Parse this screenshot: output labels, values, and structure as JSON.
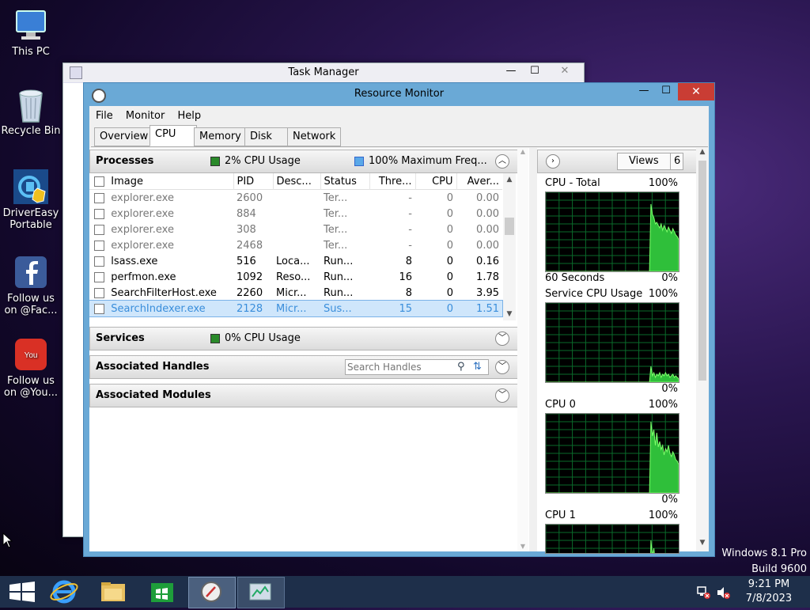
{
  "desktop": {
    "icons": [
      {
        "label": "This PC",
        "icon": "computer-icon"
      },
      {
        "label": "Recycle Bin",
        "icon": "recycle-bin-icon"
      },
      {
        "label": "DriverEasy Portable",
        "icon": "drivereasy-icon"
      },
      {
        "label": "Follow us on @Fac...",
        "icon": "facebook-icon"
      },
      {
        "label": "Follow us on @You...",
        "icon": "youtube-icon"
      }
    ],
    "watermark_line1": "Windows 8.1 Pro",
    "watermark_line2": "Build 9600"
  },
  "task_manager": {
    "title": "Task Manager"
  },
  "resource_monitor": {
    "title": "Resource Monitor",
    "menu": [
      "File",
      "Monitor",
      "Help"
    ],
    "tabs": [
      "Overview",
      "CPU",
      "Memory",
      "Disk",
      "Network"
    ],
    "active_tab": "CPU",
    "processes": {
      "title": "Processes",
      "cpu_usage": "2% CPU Usage",
      "max_freq": "100% Maximum Freq...",
      "columns": [
        "Image",
        "PID",
        "Desc...",
        "Status",
        "Thre...",
        "CPU",
        "Aver..."
      ],
      "rows": [
        {
          "image": "explorer.exe",
          "pid": "2600",
          "desc": "",
          "status": "Ter...",
          "threads": "-",
          "cpu": "0",
          "avg": "0.00",
          "terminated": true
        },
        {
          "image": "explorer.exe",
          "pid": "884",
          "desc": "",
          "status": "Ter...",
          "threads": "-",
          "cpu": "0",
          "avg": "0.00",
          "terminated": true
        },
        {
          "image": "explorer.exe",
          "pid": "308",
          "desc": "",
          "status": "Ter...",
          "threads": "-",
          "cpu": "0",
          "avg": "0.00",
          "terminated": true
        },
        {
          "image": "explorer.exe",
          "pid": "2468",
          "desc": "",
          "status": "Ter...",
          "threads": "-",
          "cpu": "0",
          "avg": "0.00",
          "terminated": true
        },
        {
          "image": "lsass.exe",
          "pid": "516",
          "desc": "Loca...",
          "status": "Run...",
          "threads": "8",
          "cpu": "0",
          "avg": "0.16"
        },
        {
          "image": "perfmon.exe",
          "pid": "1092",
          "desc": "Reso...",
          "status": "Run...",
          "threads": "16",
          "cpu": "0",
          "avg": "1.78"
        },
        {
          "image": "SearchFilterHost.exe",
          "pid": "2260",
          "desc": "Micr...",
          "status": "Run...",
          "threads": "8",
          "cpu": "0",
          "avg": "3.95"
        },
        {
          "image": "SearchIndexer.exe",
          "pid": "2128",
          "desc": "Micr...",
          "status": "Sus...",
          "threads": "15",
          "cpu": "0",
          "avg": "1.51",
          "selected": true
        }
      ]
    },
    "services": {
      "title": "Services",
      "cpu_usage": "0% CPU Usage"
    },
    "handles": {
      "title": "Associated Handles",
      "search_placeholder": "Search Handles"
    },
    "modules": {
      "title": "Associated Modules"
    },
    "right_panel": {
      "views_label": "Views",
      "views_count": "6",
      "graphs": [
        {
          "title": "CPU - Total",
          "max": "100%",
          "footer_left": "60 Seconds",
          "footer_right": "0%"
        },
        {
          "title": "Service CPU Usage",
          "max": "100%",
          "footer_left": "",
          "footer_right": "0%"
        },
        {
          "title": "CPU 0",
          "max": "100%",
          "footer_left": "",
          "footer_right": "0%"
        },
        {
          "title": "CPU 1",
          "max": "100%",
          "footer_left": "",
          "footer_right": ""
        }
      ]
    }
  },
  "taskbar": {
    "time": "9:21 PM",
    "date": "7/8/2023",
    "items": [
      "start-icon",
      "internet-explorer-icon",
      "file-explorer-icon",
      "store-icon",
      "resource-monitor-icon",
      "task-manager-icon"
    ]
  }
}
